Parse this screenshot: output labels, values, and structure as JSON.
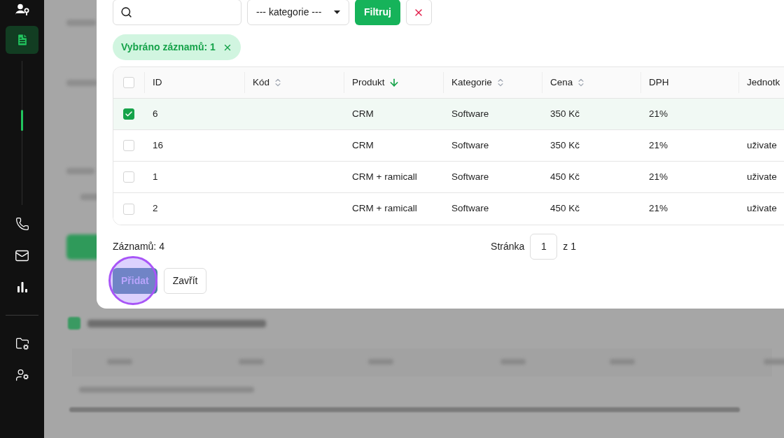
{
  "sidebar": {
    "items": [
      {
        "selected": false
      },
      {
        "selected": true
      },
      {
        "selected": false
      },
      {
        "selected": false
      },
      {
        "selected": false
      },
      {
        "selected": false
      },
      {
        "selected": false
      }
    ]
  },
  "dialog": {
    "filters": {
      "category_select": "--- kategorie ---",
      "filter_button": "Filtruj"
    },
    "selection_chip": "Vybráno záznamů: 1",
    "table": {
      "all_selected": false,
      "columns": [
        {
          "label": "ID",
          "sortable": false
        },
        {
          "label": "Kód",
          "sortable": true,
          "sorted_descending": false
        },
        {
          "label": "Produkt",
          "sorted_descending": true
        },
        {
          "label": "Kategorie",
          "sortable": true,
          "sorted_descending": false
        },
        {
          "label": "Cena",
          "sortable": true,
          "sorted_descending": false
        },
        {
          "label": "DPH",
          "sortable": false
        },
        {
          "label": "Jednotk",
          "sortable": false
        }
      ],
      "rows": [
        {
          "selected": true,
          "id": "6",
          "product": "CRM",
          "category": "Software",
          "price": "350 Kč",
          "vat": "21%"
        },
        {
          "selected": false,
          "id": "16",
          "product": "CRM",
          "category": "Software",
          "price": "350 Kč",
          "vat": "21%",
          "unit": "uživate"
        },
        {
          "selected": false,
          "id": "1",
          "product": "CRM + ramicall",
          "category": "Software",
          "price": "450 Kč",
          "vat": "21%",
          "unit": "uživate"
        },
        {
          "selected": false,
          "id": "2",
          "product": "CRM + ramicall",
          "category": "Software",
          "price": "450 Kč",
          "vat": "21%",
          "unit": "uživate"
        }
      ]
    },
    "record_count": "Záznamů: 4",
    "pagination": {
      "label": "Stránka",
      "page": "1",
      "total": "z 1"
    },
    "buttons": {
      "add": {
        "label": "Přidat",
        "highlighted": true
      },
      "close": {
        "label": "Zavřít"
      }
    }
  }
}
